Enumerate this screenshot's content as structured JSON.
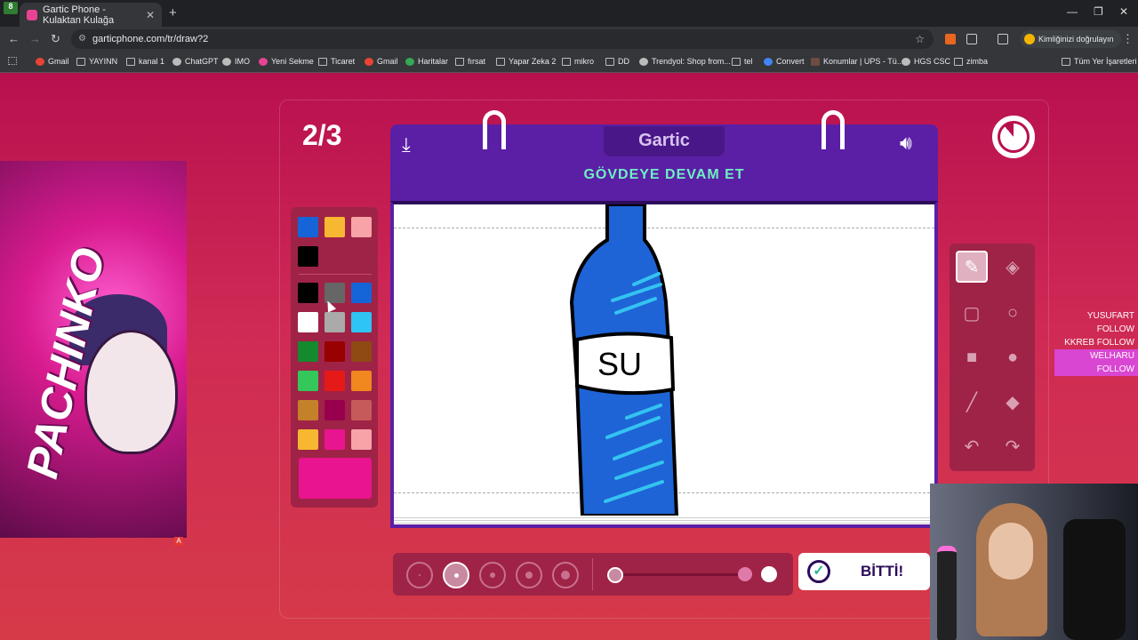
{
  "browser": {
    "tab_title": "Gartic Phone - Kulaktan Kulağa",
    "ext_badge": "8",
    "url": "garticphone.com/tr/draw?2",
    "profile_label": "Kimliğinizi doğrulayın",
    "bookmarks": [
      "Gmail",
      "YAYINN",
      "kanal 1",
      "ChatGPT",
      "IMO",
      "Yeni Sekme",
      "Ticaret",
      "Gmail",
      "Haritalar",
      "fırsat",
      "Yapar Zeka 2",
      "mikro",
      "DD",
      "Trendyol: Shop from...",
      "tel",
      "Convert",
      "Konumlar | UPS - Tü...",
      "HGS CSC",
      "zimba"
    ],
    "all_bookmarks": "Tüm Yer İşaretleri"
  },
  "game": {
    "round": "2/3",
    "logo": "Gartic",
    "task": "GÖVDEYE DEVAM ET",
    "done_label": "BİTTİ!",
    "drawing_text": "SU",
    "colors": {
      "recent": [
        "#1565d8",
        "#f7b731",
        "#f7a3a8",
        "#000000"
      ],
      "grid": [
        "#000000",
        "#666666",
        "#1565d8",
        "#ffffff",
        "#aaaaaa",
        "#2ec4f4",
        "#15892e",
        "#990000",
        "#8e4a12",
        "#34c759",
        "#e61919",
        "#f0871f",
        "#c5802a",
        "#98004e",
        "#c65a5a",
        "#f7b731",
        "#e9148f",
        "#f7a3a8"
      ],
      "selected": "#e9148f"
    },
    "brush_size_selected": 2,
    "opacity_level": 0.1
  },
  "overlay": {
    "streamer_logo": "PACHINKO",
    "badge": "A",
    "followers": [
      "YUSUFART FOLLOW",
      "KKREB FOLLOW",
      "WELHARU FOLLOW"
    ]
  },
  "icons": {
    "download": "download-icon",
    "speaker": "speaker-icon",
    "timer": "timer-icon"
  }
}
